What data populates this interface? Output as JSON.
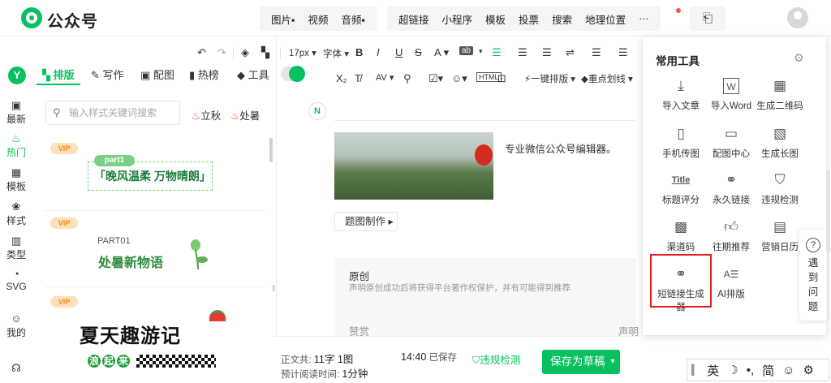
{
  "brand": {
    "name": "公众号"
  },
  "top_menu": {
    "group1": [
      "图片",
      "视频",
      "音频"
    ],
    "group2": [
      "超链接",
      "小程序",
      "模板",
      "投票",
      "搜索",
      "地理位置",
      "···"
    ]
  },
  "toolbar": {
    "row1": {
      "font_size": "17px",
      "font_family": "字体",
      "bold": "B",
      "italic": "I",
      "underline": "U",
      "strike": "S",
      "color": "A",
      "bg": "ab"
    },
    "row2": {
      "one_click": "一键排版",
      "highlight": "重点划线"
    }
  },
  "rail": [
    {
      "icon": "calendar",
      "label": "最新"
    },
    {
      "icon": "fire",
      "label": "热门"
    },
    {
      "icon": "grid",
      "label": "模板"
    },
    {
      "icon": "palette",
      "label": "样式"
    },
    {
      "icon": "books",
      "label": "类型"
    },
    {
      "icon": "dial",
      "label": "SVG"
    },
    {
      "icon": "user",
      "label": "我的"
    }
  ],
  "panel_tabs": [
    {
      "label": "排版",
      "icon": "layout"
    },
    {
      "label": "写作",
      "icon": "pen"
    },
    {
      "label": "配图",
      "icon": "image"
    },
    {
      "label": "热榜",
      "icon": "bookmark"
    },
    {
      "label": "工具",
      "icon": "cube"
    }
  ],
  "search": {
    "placeholder": "输入样式关键词搜索"
  },
  "hot_tags": [
    "立秋",
    "处暑"
  ],
  "cards": {
    "vip": "VIP",
    "c1": {
      "pill": "part1",
      "text": "「晚风温柔 万物晴朗」"
    },
    "c2": {
      "part": "PART01",
      "title": "处暑新物语"
    },
    "c3": {
      "title": "夏天趣游记",
      "sub": [
        "浪",
        "起",
        "来"
      ]
    }
  },
  "editor": {
    "cover_text": "专业微信公众号编辑器。",
    "chip": "题图制作",
    "original_title": "原创",
    "original_desc": "声明原创成功后将获得平台著作权保护，并有可能得到推荐",
    "praise": "赞赏",
    "praise_right": "声明"
  },
  "bottom": {
    "body_label": "正文共:",
    "count": "11字 1图",
    "read_label": "预计阅读时间:",
    "read_time": "1分钟",
    "time": "14:40",
    "saved": "已保存",
    "check": "违规检测",
    "save_draft": "保存为草稿"
  },
  "tools": {
    "title": "常用工具",
    "items": [
      {
        "label": "导入文章",
        "icon": "download"
      },
      {
        "label": "导入Word",
        "icon": "word"
      },
      {
        "label": "生成二维码",
        "icon": "qrcode"
      },
      {
        "label": "手机传图",
        "icon": "phone-upload"
      },
      {
        "label": "配图中心",
        "icon": "picture"
      },
      {
        "label": "生成长图",
        "icon": "long-image"
      },
      {
        "label": "标题评分",
        "icon": "title"
      },
      {
        "label": "永久链接",
        "icon": "link"
      },
      {
        "label": "违规检测",
        "icon": "shield"
      },
      {
        "label": "渠道码",
        "icon": "qrcode-alt"
      },
      {
        "label": "往期推荐",
        "icon": "thumbs-up"
      },
      {
        "label": "营销日历",
        "icon": "calendar"
      },
      {
        "label": "短链接生成器",
        "icon": "short-link"
      },
      {
        "label": "AI排版",
        "icon": "ai-layout"
      }
    ]
  },
  "help": {
    "chars": [
      "遇",
      "到",
      "问",
      "题"
    ]
  },
  "ime": [
    "英",
    "简"
  ]
}
